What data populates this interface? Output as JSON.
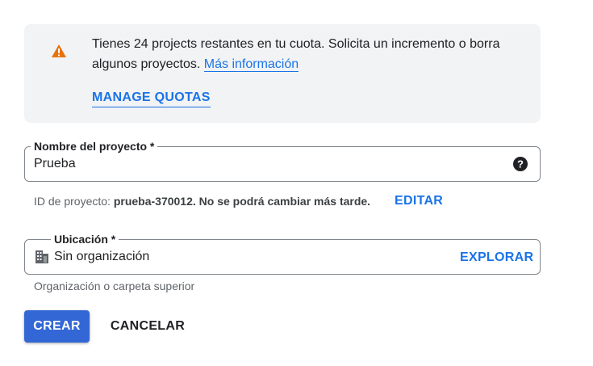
{
  "quota_banner": {
    "message": "Tienes 24 projects restantes en tu cuota. Solicita un incremento o borra algunos proyectos.",
    "more_info_link": "Más información",
    "manage_quotas_label": "MANAGE QUOTAS",
    "icon": "warning-icon",
    "accent_color": "#e8710a"
  },
  "project_name": {
    "label": "Nombre del proyecto *",
    "value": "Prueba",
    "help_icon": "help-icon"
  },
  "project_id": {
    "prefix": "ID de proyecto:",
    "value_text": "prueba-370012. No se podrá cambiar más tarde.",
    "edit_label": "EDITAR"
  },
  "location": {
    "label": "Ubicación *",
    "value": "Sin organización",
    "browse_label": "EXPLORAR",
    "hint": "Organización o carpeta superior",
    "icon": "organization-icon"
  },
  "actions": {
    "create_label": "CREAR",
    "cancel_label": "CANCELAR"
  },
  "colors": {
    "primary": "#1a73e8",
    "primary_button": "#3367d6"
  }
}
